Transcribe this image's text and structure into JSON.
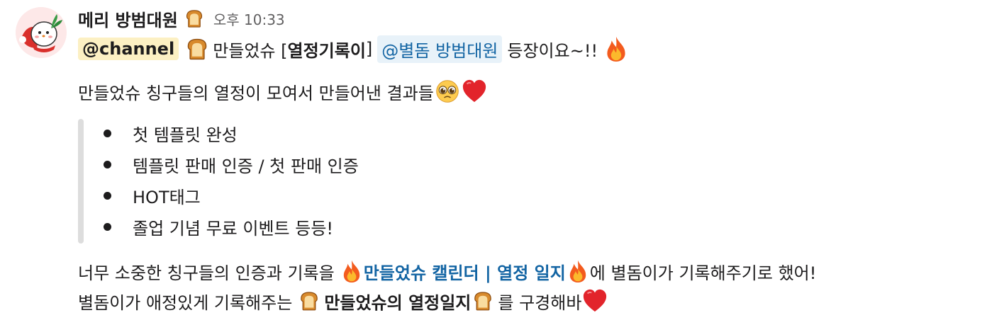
{
  "message": {
    "sender": "메리 방범대원",
    "timestamp": "오후 10:33",
    "line1": {
      "channel_mention": "@channel",
      "text_a": "만들었슈 [",
      "bold": "열정기록이",
      "text_b": "]",
      "user_mention": "@별돔 방범대원",
      "text_c": "등장이요~!!"
    },
    "line2": {
      "text": "만들었슈 칭구들의 열정이 모여서 만들어낸 결과들"
    },
    "bullets": [
      "첫 템플릿 완성",
      "템플릿 판매 인증 / 첫 판매 인증",
      "HOT태그",
      "졸업 기념 무료 이벤트 등등!"
    ],
    "line3": {
      "text_a": "너무 소중한 칭구들의 인증과 기록을",
      "link": "만들었슈 캘린더 | 열정 일지",
      "text_b": "에 별돔이가 기록해주기로 했어!"
    },
    "line4": {
      "text_a": "별돔이가 애정있게 기록해주는",
      "bold": "만들었슈의 열정일지",
      "text_b": "를 구경해바"
    }
  },
  "emojis": {
    "bread": "bread-emoji",
    "fire": "fire-emoji",
    "pleading": "pleading-face-emoji",
    "heart": "red-heart-emoji"
  },
  "colors": {
    "mention_user_bg": "#e8f2f9",
    "mention_user_text": "#1264a3",
    "mention_channel_bg": "#fcf0c3",
    "link": "#1264a3",
    "text": "#1d1c1d",
    "timestamp": "#616061",
    "quote_bar": "#dddddd"
  }
}
